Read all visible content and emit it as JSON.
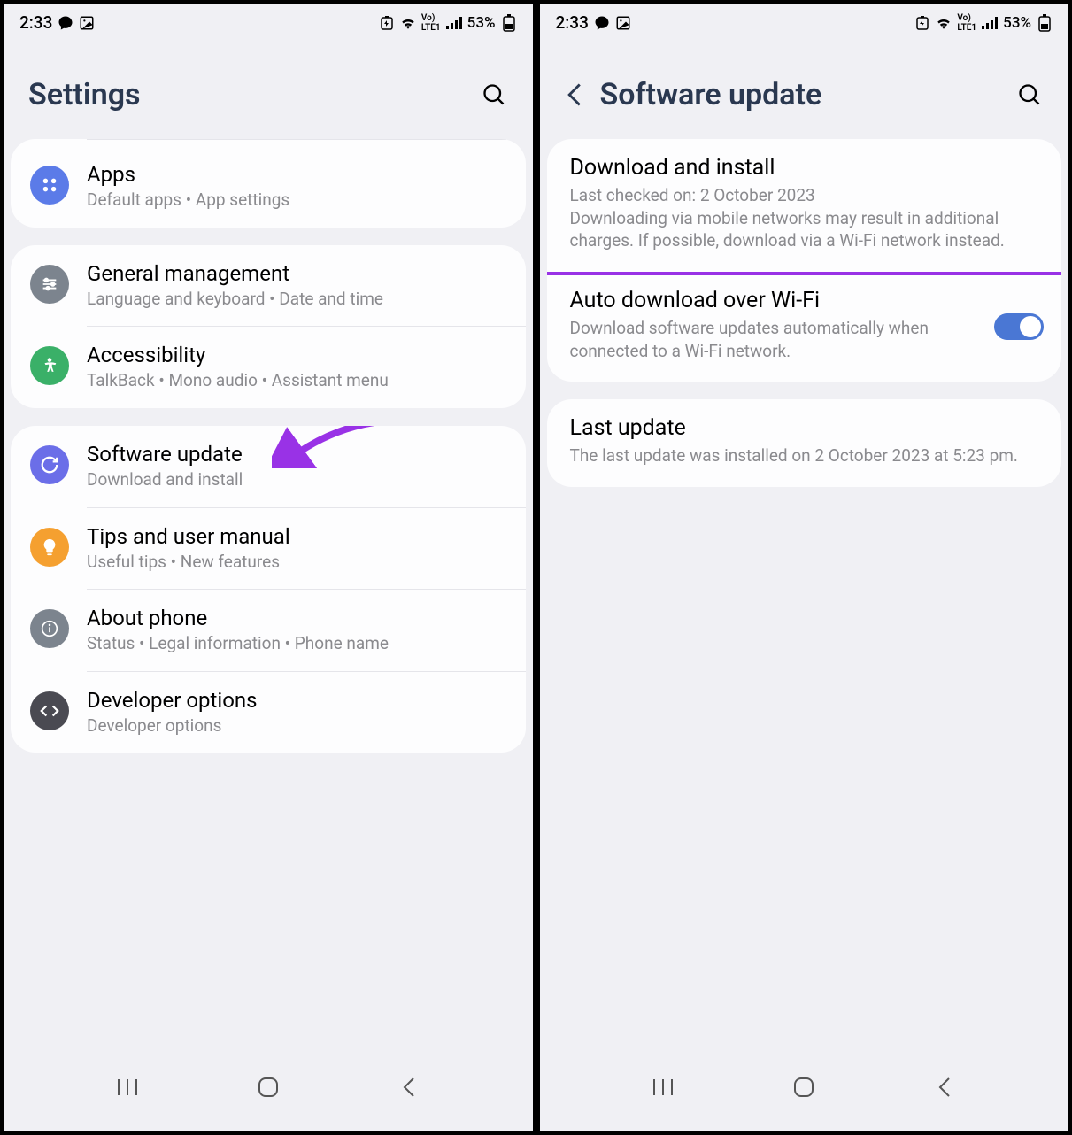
{
  "statusBar": {
    "time": "2:33",
    "battery": "53%"
  },
  "left": {
    "title": "Settings",
    "items": {
      "apps": {
        "title": "Apps",
        "subtitle": "Default apps  •  App settings"
      },
      "general": {
        "title": "General management",
        "subtitle": "Language and keyboard  •  Date and time"
      },
      "accessibility": {
        "title": "Accessibility",
        "subtitle": "TalkBack  •  Mono audio  •  Assistant menu"
      },
      "software": {
        "title": "Software update",
        "subtitle": "Download and install"
      },
      "tips": {
        "title": "Tips and user manual",
        "subtitle": "Useful tips  •  New features"
      },
      "about": {
        "title": "About phone",
        "subtitle": "Status  •  Legal information  •  Phone name"
      },
      "dev": {
        "title": "Developer options",
        "subtitle": "Developer options"
      }
    }
  },
  "right": {
    "title": "Software update",
    "download": {
      "title": "Download and install",
      "line1": "Last checked on: 2 October 2023",
      "line2": "Downloading via mobile networks may result in additional charges. If possible, download via a Wi-Fi network instead."
    },
    "auto": {
      "title": "Auto download over Wi-Fi",
      "subtitle": "Download software updates automatically when connected to a Wi-Fi network."
    },
    "last": {
      "title": "Last update",
      "subtitle": "The last update was installed on 2 October 2023 at 5:23 pm."
    }
  }
}
